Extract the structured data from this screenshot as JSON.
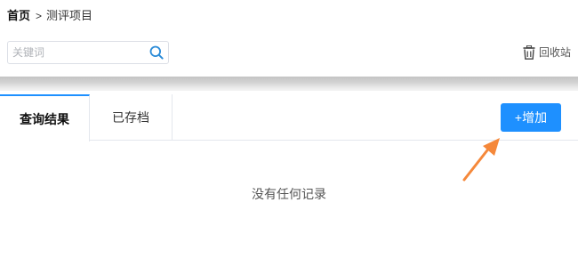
{
  "breadcrumb": {
    "home": "首页",
    "separator": ">",
    "current": "测评项目"
  },
  "search": {
    "placeholder": "关键词",
    "value": "",
    "icon": "search-icon"
  },
  "toolbar": {
    "recycle_label": "回收站",
    "recycle_icon": "trash-icon"
  },
  "tabs": [
    {
      "label": "查询结果",
      "active": true
    },
    {
      "label": "已存档",
      "active": false
    }
  ],
  "actions": {
    "add_label": "+增加",
    "add_color": "#1e90ff"
  },
  "results": {
    "empty_text": "没有任何记录"
  },
  "annotation": {
    "arrow_color": "#f5883a",
    "arrow_icon": "arrow-icon"
  }
}
